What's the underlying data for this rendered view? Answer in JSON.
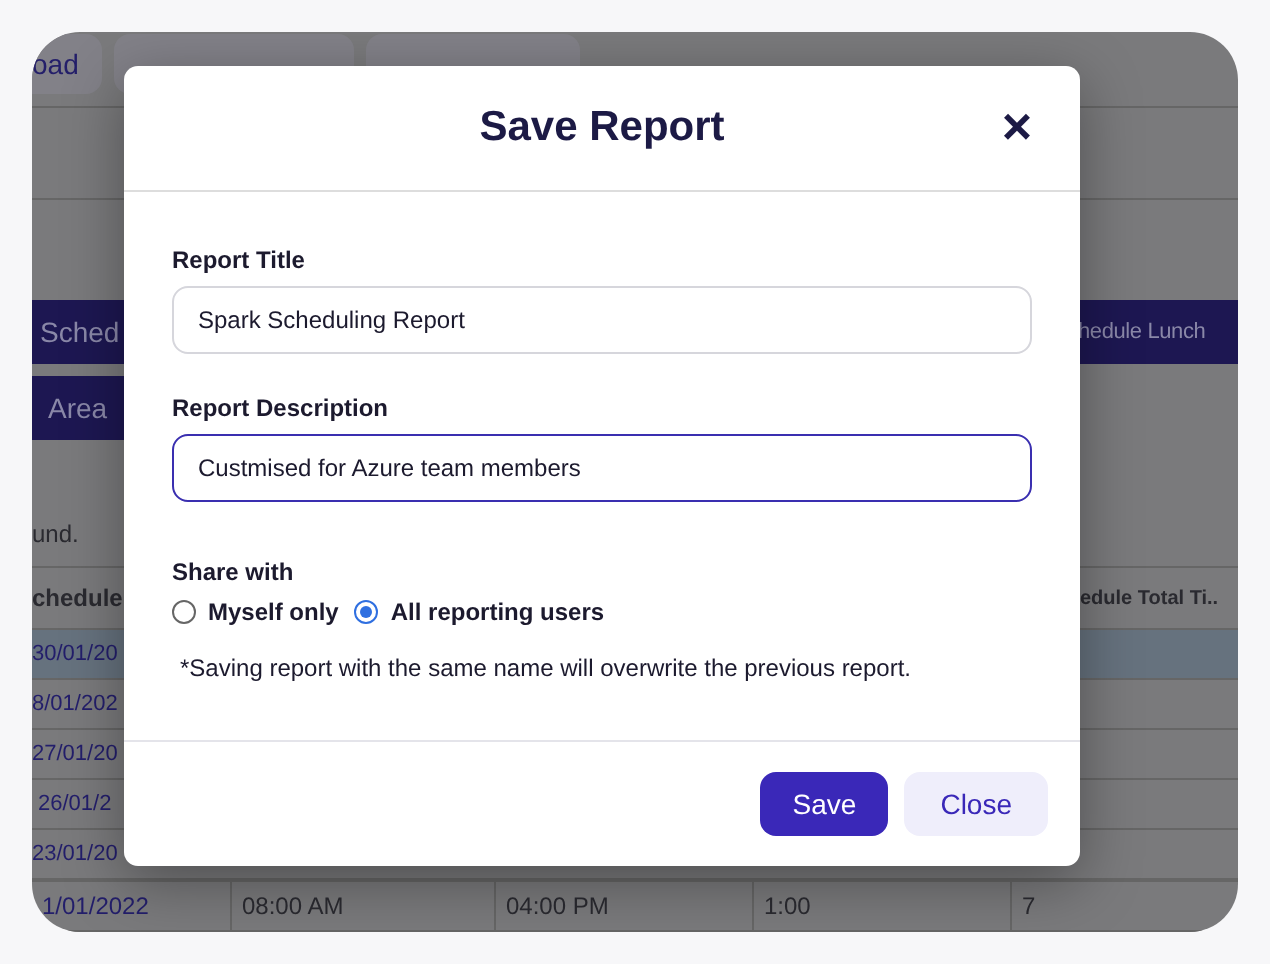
{
  "background": {
    "toolbar_buttons": [
      "oad"
    ],
    "action_buttons": [
      {
        "left": "Sched",
        "right": "hedule Lunch"
      },
      {
        "left": "Area"
      }
    ],
    "result_text": "und.",
    "table": {
      "header_left": "chedule",
      "header_right": "edule Total Ti..",
      "rows": [
        {
          "column_1": "30/01/20",
          "highlighted": true
        },
        {
          "column_1": "8/01/202",
          "highlighted": false
        },
        {
          "column_1": "27/01/20",
          "highlighted": false
        },
        {
          "column_1": "26/01/2",
          "highlighted": false
        },
        {
          "column_1": "23/01/20",
          "highlighted": false
        }
      ],
      "last_row": [
        "1/01/2022",
        "08:00 AM",
        "04:00 PM",
        "1:00",
        "7"
      ]
    }
  },
  "dialog": {
    "title": "Save Report",
    "close_icon": "×",
    "fields": [
      {
        "label": "Report Title",
        "value": "Spark Scheduling Report",
        "focused": false
      },
      {
        "label": "Report Description",
        "value": "Custmised for Azure team members",
        "focused": true
      }
    ],
    "share_with": {
      "label": "Share with",
      "options": [
        {
          "label": "Myself only",
          "selected": false
        },
        {
          "label": "All reporting users",
          "selected": true
        }
      ]
    },
    "note": "*Saving report with the same name will overwrite the previous report.",
    "buttons": [
      {
        "label": "Save",
        "kind": "primary"
      },
      {
        "label": "Close",
        "kind": "secondary"
      }
    ]
  }
}
